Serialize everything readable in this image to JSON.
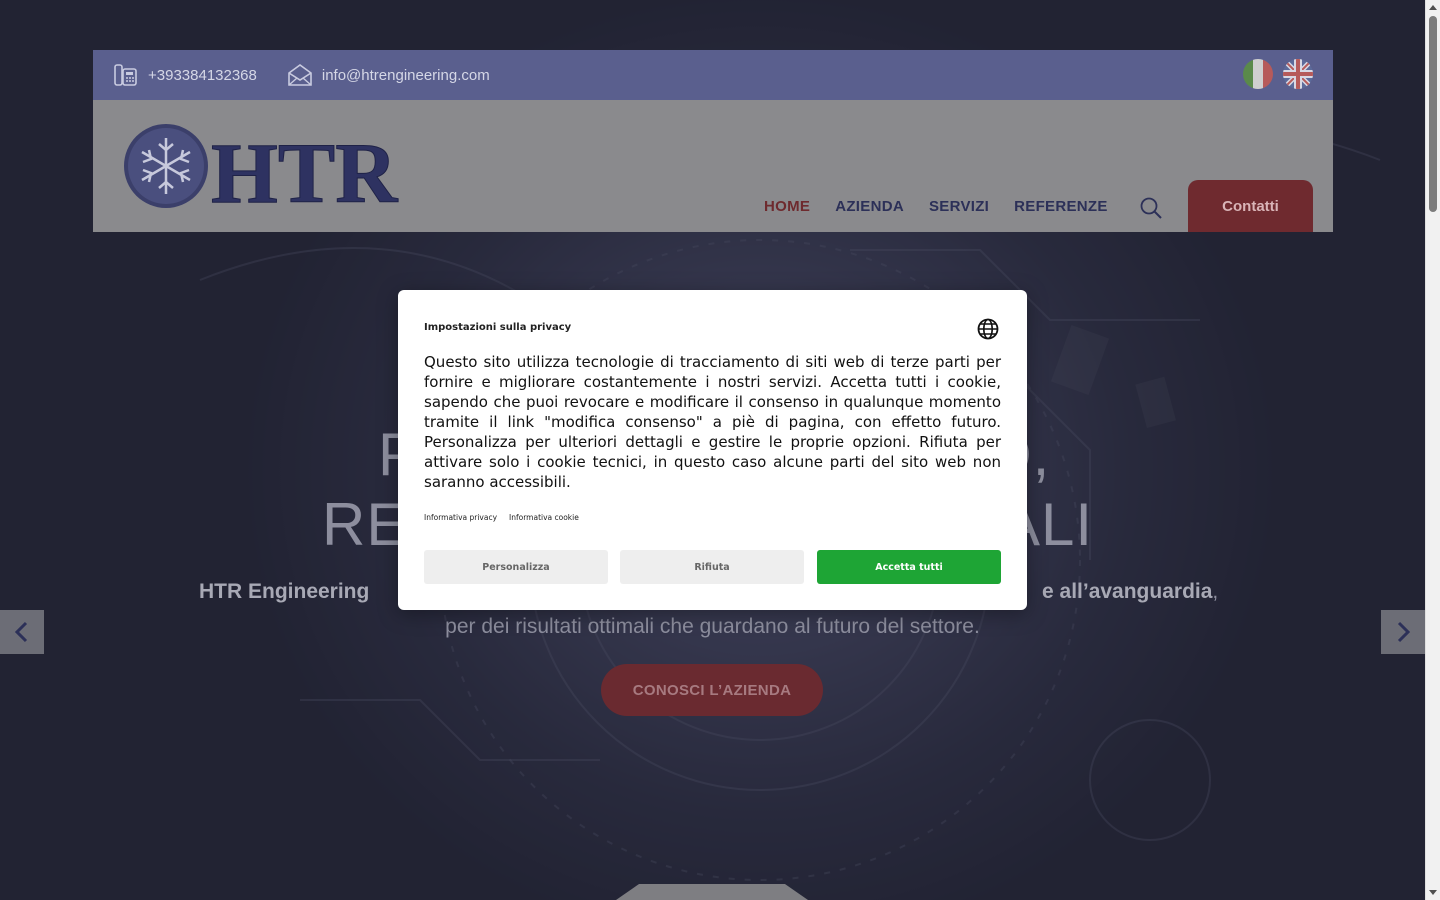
{
  "topbar": {
    "phone": "+393384132368",
    "email": "info@htrengineering.com",
    "phone_icon": "phone-icon",
    "email_icon": "email-icon"
  },
  "header": {
    "logo_text": "HTR",
    "nav": [
      {
        "label": "HOME",
        "active": true
      },
      {
        "label": "AZIENDA"
      },
      {
        "label": "SERVIZI"
      },
      {
        "label": "REFERENZE"
      }
    ],
    "contact_button": "Contatti"
  },
  "hero": {
    "title_line1_left": "P",
    "title_line1_right": "O,",
    "title_line2_left": "RE",
    "title_line2_right": "ALI",
    "subtitle_left_bold": "HTR Engineering",
    "subtitle_right_bold": "e all’avanguardia",
    "subtitle_right_end": ",",
    "subtitle_line2": "per dei risultati ottimali che guardano al futuro del settore.",
    "cta": "CONOSCI L’AZIENDA"
  },
  "cookie_modal": {
    "title": "Impostazioni sulla privacy",
    "body": "Questo sito utilizza tecnologie di tracciamento di siti web di terze parti per fornire e migliorare costantemente i nostri servizi. Accetta tutti i cookie, sapendo che puoi revocare e modificare il consenso in qualunque momento tramite il link \"modifica consenso\" a piè di pagina, con effetto futuro. Personalizza per ulteriori dettagli e gestire le proprie opzioni. Rifiuta per attivare solo i cookie tecnici, in questo caso alcune parti del sito web non saranno accessibili.",
    "link_privacy": "Informativa privacy",
    "link_cookie": "Informativa cookie",
    "btn_customize": "Personalizza",
    "btn_reject": "Rifiuta",
    "btn_accept": "Accetta tutti"
  },
  "colors": {
    "topbar": "#5a5f8e",
    "accent_red": "#b5343d",
    "accept_green": "#1ea535",
    "nav_blue": "#2c3058"
  }
}
